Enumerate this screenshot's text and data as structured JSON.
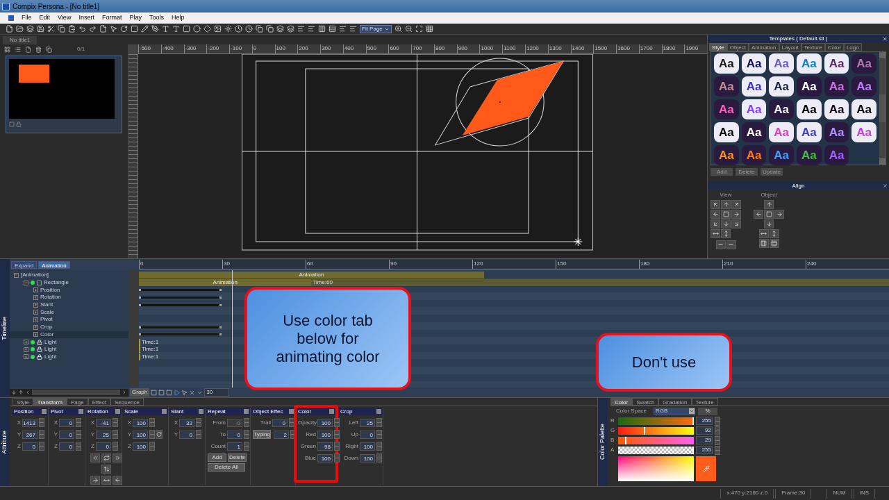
{
  "window": {
    "title": "Compix Persona - [No title1]"
  },
  "menu": [
    "File",
    "Edit",
    "View",
    "Insert",
    "Format",
    "Play",
    "Tools",
    "Help"
  ],
  "toolbar": {
    "zoom": "Fit Page"
  },
  "document_tab": {
    "label": "No title1",
    "selected": true
  },
  "pages": {
    "count": "0/1"
  },
  "canvas": {
    "ruler": [
      "-500",
      "-400",
      "-300",
      "-200",
      "-100",
      "0",
      "100",
      "200",
      "300",
      "400",
      "500",
      "600",
      "700",
      "800",
      "900",
      "1000",
      "1100",
      "1200",
      "1300",
      "1400",
      "1500",
      "1600",
      "1700",
      "1800",
      "1900"
    ]
  },
  "templates": {
    "title": "Templates ( Default.stl )",
    "tabs": [
      {
        "label": "Style",
        "selected": true
      },
      {
        "label": "Object",
        "selected": false
      },
      {
        "label": "Animation",
        "selected": false
      },
      {
        "label": "Layout",
        "selected": false
      },
      {
        "label": "Texture",
        "selected": false
      },
      {
        "label": "Color",
        "selected": false
      },
      {
        "label": "Logo",
        "selected": false
      }
    ],
    "items": [
      {
        "text": "Aa",
        "color": "#1a1a1a"
      },
      {
        "text": "Aa",
        "color": "#101060"
      },
      {
        "text": "Aa",
        "color": "#6a5acd"
      },
      {
        "text": "Aa",
        "color": "#1080c0"
      },
      {
        "text": "Aa",
        "color": "#5a2a6a"
      },
      {
        "text": "Aa",
        "color": "#b07ab0"
      },
      {
        "text": "Aa",
        "color": "#c09090"
      },
      {
        "text": "Aa",
        "color": "#4030c0"
      },
      {
        "text": "Aa",
        "color": "#202848"
      },
      {
        "text": "Aa",
        "color": "#ffffff"
      },
      {
        "text": "Aa",
        "color": "#d070e0"
      },
      {
        "text": "Aa",
        "color": "#c080ff"
      },
      {
        "text": "Aa",
        "color": "#ff60c0"
      },
      {
        "text": "Aa",
        "color": "#8040ff"
      },
      {
        "text": "Aa",
        "color": "#f0f0f0"
      },
      {
        "text": "Aa",
        "color": "#000000"
      },
      {
        "text": "Aa",
        "color": "#100010"
      },
      {
        "text": "Aa",
        "color": "#080808"
      },
      {
        "text": "Aa",
        "color": "#050505"
      },
      {
        "text": "Aa",
        "color": "#fafafa"
      },
      {
        "text": "Aa",
        "color": "#e040c0"
      },
      {
        "text": "Aa",
        "color": "#4040c0"
      },
      {
        "text": "Aa",
        "color": "#b090ff"
      },
      {
        "text": "Aa",
        "color": "#c040e0"
      },
      {
        "text": "Aa",
        "color": "#ff9020"
      },
      {
        "text": "Aa",
        "color": "#ff7a10"
      },
      {
        "text": "Aa",
        "color": "#40a0ff"
      },
      {
        "text": "Aa",
        "color": "#40c040"
      },
      {
        "text": "Aa",
        "color": "#a060ff"
      }
    ],
    "buttons": [
      "Add",
      "Delete",
      "Update"
    ]
  },
  "align": {
    "title": "Align",
    "view_label": "View",
    "object_label": "Object"
  },
  "timeline": {
    "label": "Timeline",
    "buttons": [
      {
        "label": "Expand",
        "selected": false
      },
      {
        "label": "Animation",
        "selected": true
      }
    ],
    "ruler": [
      "0",
      "30",
      "60",
      "90",
      "120",
      "150",
      "180",
      "210",
      "240"
    ],
    "tree": [
      {
        "label": "[Animation]",
        "expanded": true,
        "selected": false,
        "children": [
          {
            "label": "Rectangle",
            "expanded": true,
            "selected": false,
            "visible": true,
            "locked": false,
            "children": [
              {
                "label": "Position",
                "expanded": false,
                "selected": false
              },
              {
                "label": "Rotation",
                "expanded": false,
                "selected": false
              },
              {
                "label": "Slant",
                "expanded": false,
                "selected": false
              },
              {
                "label": "Scale",
                "expanded": false,
                "selected": false
              },
              {
                "label": "Pivot",
                "expanded": false,
                "selected": false
              },
              {
                "label": "Crop",
                "expanded": false,
                "selected": false
              },
              {
                "label": "Color",
                "expanded": false,
                "selected": true
              }
            ]
          },
          {
            "label": "Light",
            "expanded": false,
            "selected": false,
            "visible": true,
            "locked": true
          },
          {
            "label": "Light",
            "expanded": false,
            "selected": false,
            "visible": true,
            "locked": true
          },
          {
            "label": "Light",
            "expanded": false,
            "selected": false,
            "visible": true,
            "locked": true
          }
        ]
      }
    ],
    "tracks": [
      {
        "kind": "clip",
        "label": "Animation",
        "level": 0.46
      },
      {
        "kind": "clip",
        "label": "Animation",
        "note": "Time:60",
        "level": 0.23
      },
      {
        "kind": "keys",
        "level": 0.11
      },
      {
        "kind": "keys",
        "level": 0.11
      },
      {
        "kind": "keys",
        "level": 0.11
      },
      {
        "kind": "empty"
      },
      {
        "kind": "empty"
      },
      {
        "kind": "keys",
        "level": 0.11
      },
      {
        "kind": "keys",
        "level": 0.11
      },
      {
        "kind": "time",
        "label": "Time:1"
      },
      {
        "kind": "time",
        "label": "Time:1"
      },
      {
        "kind": "time",
        "label": "Time:1"
      }
    ],
    "graph_button": "Graph",
    "frame": "30"
  },
  "attribute": {
    "label": "Attribute",
    "tabs": [
      {
        "label": "Style",
        "selected": false
      },
      {
        "label": "Transform",
        "selected": true
      },
      {
        "label": "Page",
        "selected": false
      },
      {
        "label": "Effect",
        "selected": false
      },
      {
        "label": "Sequence",
        "selected": false
      }
    ],
    "groups": [
      {
        "title": "Position",
        "kind": "plain",
        "highlighted": false,
        "fields": [
          {
            "label": "X",
            "kind": "label",
            "value": "1413"
          },
          {
            "label": "Y",
            "kind": "label",
            "value": "267"
          },
          {
            "label": "Z",
            "kind": "label",
            "value": "0"
          }
        ]
      },
      {
        "title": "Pivot",
        "kind": "plain",
        "highlighted": false,
        "fields": [
          {
            "label": "X",
            "kind": "label",
            "value": "0"
          },
          {
            "label": "Y",
            "kind": "label",
            "value": "0"
          },
          {
            "label": "Z",
            "kind": "label",
            "value": "0"
          }
        ]
      },
      {
        "title": "Rotation",
        "kind": "rotation",
        "highlighted": false,
        "fields": [
          {
            "label": "X",
            "kind": "label",
            "value": "-41"
          },
          {
            "label": "Y",
            "kind": "label",
            "value": "25"
          },
          {
            "label": "Z",
            "kind": "label",
            "value": "0"
          }
        ]
      },
      {
        "title": "Scale",
        "kind": "scale",
        "highlighted": false,
        "fields": [
          {
            "label": "X",
            "kind": "label",
            "value": "100"
          },
          {
            "label": "Y",
            "kind": "label",
            "value": "100"
          },
          {
            "label": "Z",
            "kind": "label",
            "value": "100"
          }
        ]
      },
      {
        "title": "Slant",
        "kind": "plain",
        "highlighted": false,
        "fields": [
          {
            "label": "X",
            "kind": "label",
            "value": "32"
          },
          {
            "label": "Y",
            "kind": "label",
            "value": "0"
          }
        ]
      },
      {
        "title": "Repeat",
        "kind": "repeat",
        "highlighted": false,
        "fields": [
          {
            "label": "From",
            "kind": "label",
            "value": "0",
            "disabled": true
          },
          {
            "label": "To",
            "kind": "label",
            "value": "0",
            "disabled": false
          },
          {
            "label": "Count",
            "kind": "label",
            "value": "1",
            "disabled": false
          }
        ],
        "buttons": [
          "Add",
          "Delete",
          "Delete All"
        ]
      },
      {
        "title": "Object Effec",
        "kind": "plain",
        "highlighted": false,
        "fields": [
          {
            "label": "Trail",
            "kind": "label",
            "value": "0"
          },
          {
            "label": "Typing",
            "kind": "button",
            "value": "2"
          }
        ]
      },
      {
        "title": "Color",
        "kind": "plain",
        "highlighted": true,
        "fields": [
          {
            "label": "Opacity",
            "kind": "label",
            "value": "100"
          },
          {
            "label": "Red",
            "kind": "label",
            "value": "100"
          },
          {
            "label": "Green",
            "kind": "label",
            "value": "98"
          },
          {
            "label": "Blue",
            "kind": "label",
            "value": "100"
          }
        ]
      },
      {
        "title": "Crop",
        "kind": "plain",
        "highlighted": false,
        "fields": [
          {
            "label": "Left",
            "kind": "label",
            "value": "25"
          },
          {
            "label": "Up",
            "kind": "label",
            "value": "0"
          },
          {
            "label": "Right",
            "kind": "label",
            "value": "100"
          },
          {
            "label": "Down",
            "kind": "label",
            "value": "100"
          }
        ]
      }
    ]
  },
  "color_palette": {
    "label": "Color Palette",
    "tabs": [
      {
        "label": "Color",
        "selected": true
      },
      {
        "label": "Swatch",
        "selected": false
      },
      {
        "label": "Gradation",
        "selected": false
      },
      {
        "label": "Texture",
        "selected": false
      }
    ],
    "color_space_label": "Color Space",
    "color_space": "RGB",
    "percent_button": "%",
    "channels": [
      {
        "name": "R",
        "value": "255",
        "level": 1
      },
      {
        "name": "G",
        "value": "92",
        "level": 0.36
      },
      {
        "name": "B",
        "value": "29",
        "level": 0.11
      },
      {
        "name": "A",
        "value": "255",
        "level": 1
      }
    ],
    "preview": {
      "color": "#ff5c1d"
    }
  },
  "callouts": [
    {
      "text": "Use color tab below for animating color"
    },
    {
      "text": "Don't use"
    }
  ],
  "status_bar": [
    "x:470 y:2160 z:0",
    "Frame:30",
    "NUM",
    "INS"
  ]
}
